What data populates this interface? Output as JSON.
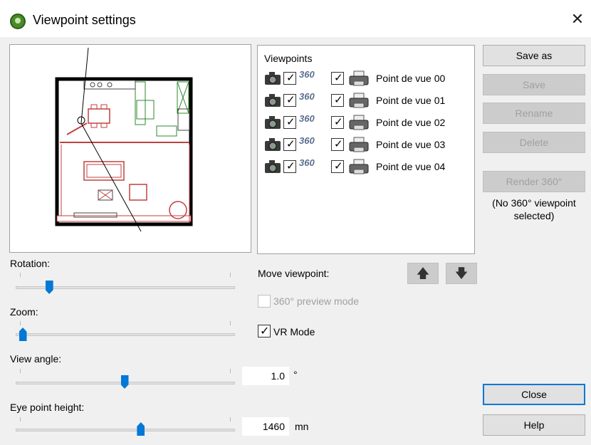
{
  "window": {
    "title": "Viewpoint settings",
    "close_glyph": "✕"
  },
  "preview": {
    "description_icon": "floor-plan"
  },
  "sliders": {
    "rotation_label": "Rotation:",
    "rotation_fraction": 0.13,
    "zoom_label": "Zoom:",
    "zoom_fraction": 0.0,
    "view_angle_label": "View angle:",
    "view_angle_fraction": 0.5,
    "view_angle_value": "1.0",
    "view_angle_unit": "°",
    "eye_height_label": "Eye point height:",
    "eye_height_fraction": 0.58,
    "eye_height_value": "1460",
    "eye_height_unit": "mn"
  },
  "viewpoints": {
    "header": "Viewpoints",
    "items": [
      {
        "label": "Point de vue 00"
      },
      {
        "label": "Point de vue 01"
      },
      {
        "label": "Point de vue 02"
      },
      {
        "label": "Point de vue 03"
      },
      {
        "label": "Point de vue 04"
      }
    ],
    "pano_text": "360"
  },
  "controls": {
    "move_label": "Move viewpoint:",
    "up_glyph": "🡅",
    "down_glyph": "🡇",
    "preview_mode_label": "360° preview mode",
    "vr_mode_label": "VR Mode",
    "check_glyph": "✓"
  },
  "buttons": {
    "save_as": "Save as",
    "save": "Save",
    "rename": "Rename",
    "delete": "Delete",
    "render360": "Render 360°",
    "render_note": "(No 360° viewpoint selected)",
    "close": "Close",
    "help": "Help"
  },
  "colors": {
    "accent": "#0078d7",
    "disabled_text": "#a0a0a0"
  }
}
